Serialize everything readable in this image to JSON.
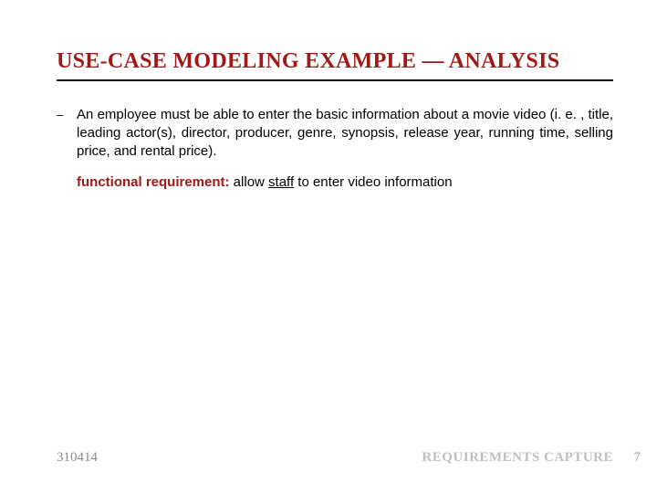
{
  "title": "USE-CASE MODELING EXAMPLE — ANALYSIS",
  "bullet": {
    "dash": "–",
    "text": "An employee must be able to enter the basic information about a movie video (i. e. , title, leading actor(s), director, producer, genre, synopsis, release year, running time, selling price, and rental price)."
  },
  "requirement": {
    "label": "functional requirement:",
    "before": "  allow ",
    "underlined": "staff",
    "after": " to enter video information"
  },
  "footer": {
    "left": "310414",
    "right": "REQUIREMENTS CAPTURE",
    "page": "7"
  }
}
